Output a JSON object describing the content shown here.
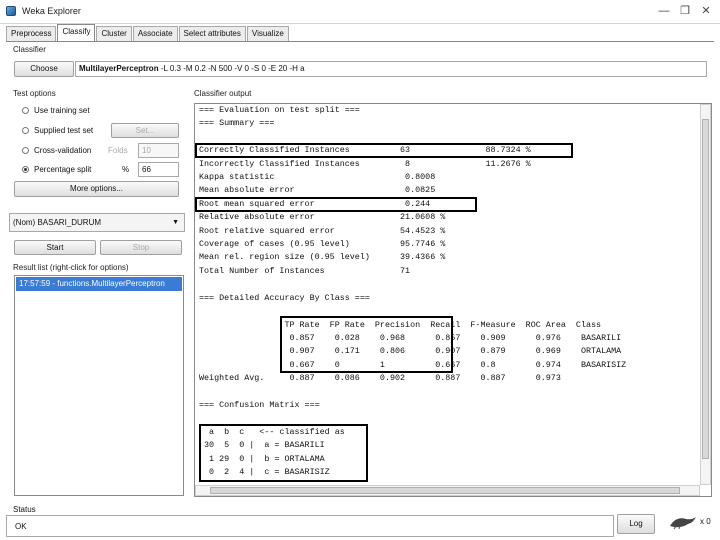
{
  "window": {
    "title": "Weka Explorer",
    "controls": [
      "—",
      "❐",
      "✕"
    ]
  },
  "tabs": [
    "Preprocess",
    "Classify",
    "Cluster",
    "Associate",
    "Select attributes",
    "Visualize"
  ],
  "classifier": {
    "group_label": "Classifier",
    "choose_label": "Choose",
    "name": "MultilayerPerceptron",
    "options": "-L 0.3 -M 0.2 -N 500 -V 0 -S 0 -E 20 -H a"
  },
  "test_options": {
    "group_label": "Test options",
    "use_training_set": "Use training set",
    "supplied_test_set": "Supplied test set",
    "set_button": "Set...",
    "cross_validation": "Cross-validation",
    "folds_label": "Folds",
    "folds_value": "10",
    "percentage_split": "Percentage split",
    "percent_label": "%",
    "percent_value": "66",
    "more_options": "More options..."
  },
  "class_select": "(Nom) BASARI_DURUM",
  "start_label": "Start",
  "stop_label": "Stop",
  "result_list": {
    "label": "Result list (right-click for options)",
    "items": [
      "17:57:59 - functions.MultilayerPerceptron"
    ]
  },
  "output": {
    "label": "Classifier output",
    "lines": [
      "=== Evaluation on test split ===",
      "=== Summary ===",
      "",
      "Correctly Classified Instances          63               88.7324 %",
      "Incorrectly Classified Instances         8               11.2676 %",
      "Kappa statistic                          0.8008",
      "Mean absolute error                      0.0825",
      "Root mean squared error                  0.244",
      "Relative absolute error                 21.0608 %",
      "Root relative squared error             54.4523 %",
      "Coverage of cases (0.95 level)          95.7746 %",
      "Mean rel. region size (0.95 level)      39.4366 %",
      "Total Number of Instances               71",
      "",
      "=== Detailed Accuracy By Class ===",
      "",
      "                 TP Rate  FP Rate  Precision  Recall  F-Measure  ROC Area  Class",
      "                  0.857    0.028    0.968      0.857    0.909      0.976    BASARILI",
      "                  0.907    0.171    0.806      0.907    0.879      0.969    ORTALAMA",
      "                  0.667    0        1          0.667    0.8        0.974    BASARISIZ",
      "Weighted Avg.     0.887    0.086    0.902      0.887    0.887      0.973",
      "",
      "=== Confusion Matrix ===",
      "",
      "  a  b  c   <-- classified as",
      " 30  5  0 |  a = BASARILI",
      "  1 29  0 |  b = ORTALAMA",
      "  0  2  4 |  c = BASARISIZ"
    ]
  },
  "status": {
    "label": "Status",
    "text": "OK",
    "log_label": "Log",
    "count": "x 0"
  }
}
